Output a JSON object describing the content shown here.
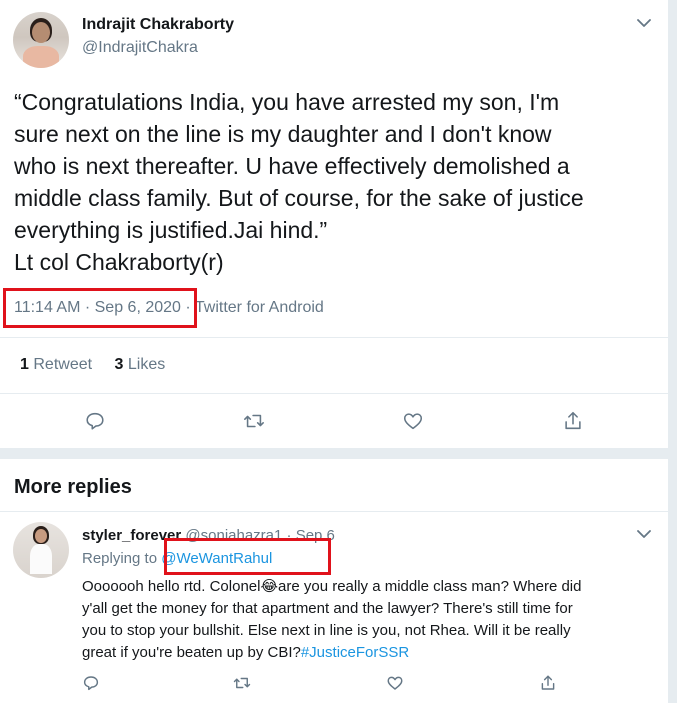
{
  "tweet": {
    "author_name": "Indrajit Chakraborty",
    "author_handle": "@IndrajitChakra",
    "text_lines": [
      "“Congratulations India, you have arrested my son, I'm",
      "sure next on the line is my daughter and I don't know",
      "who is next thereafter. U have effectively demolished a",
      "middle class family. But of course, for the sake of justice",
      "everything is justified.Jai hind.”",
      "Lt col Chakraborty(r)"
    ],
    "timestamp": "11:14 AM · Sep 6, 2020",
    "separator": " · ",
    "source": "Twitter for Android",
    "retweets_count": "1",
    "retweets_label": "Retweet",
    "likes_count": "3",
    "likes_label": "Likes"
  },
  "section_title": "More replies",
  "reply": {
    "author_name": "styler_forever",
    "author_handle": "@soniahazra1",
    "date": "Sep 6",
    "replying_label": "Replying to",
    "replying_to": "@WeWantRahul",
    "text_line1_a": "Ooooooh hello rtd. Colonel",
    "emoji": "😂",
    "text_line1_b": "are you really a middle class man? Where did",
    "text_line2": "y'all get the money for that apartment and the lawyer? There's still time for",
    "text_line3": "you to stop your bullshit. Else next in line is you, not Rhea. Will it be really",
    "text_line4_a": "great if you're beaten up by CBI?",
    "hashtag": "#JusticeForSSR"
  },
  "colors": {
    "accent": "#1b95e0",
    "muted": "#657786",
    "highlight_box": "#e0121b",
    "divider": "#e6ecf0"
  },
  "icons": [
    "chevron-down-icon",
    "reply-icon",
    "retweet-icon",
    "like-icon",
    "share-icon"
  ]
}
